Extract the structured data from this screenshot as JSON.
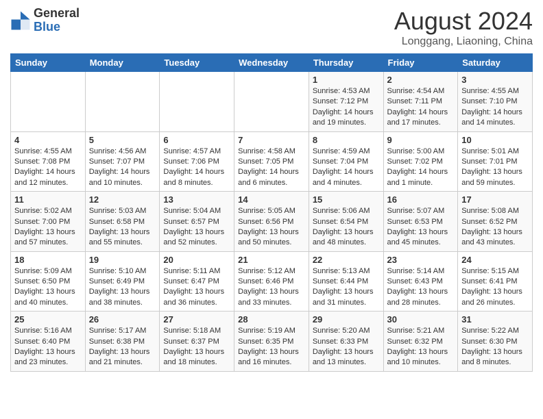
{
  "header": {
    "logo_general": "General",
    "logo_blue": "Blue",
    "month_title": "August 2024",
    "location": "Longgang, Liaoning, China"
  },
  "days_of_week": [
    "Sunday",
    "Monday",
    "Tuesday",
    "Wednesday",
    "Thursday",
    "Friday",
    "Saturday"
  ],
  "weeks": [
    [
      {
        "day": "",
        "content": ""
      },
      {
        "day": "",
        "content": ""
      },
      {
        "day": "",
        "content": ""
      },
      {
        "day": "",
        "content": ""
      },
      {
        "day": "1",
        "content": "Sunrise: 4:53 AM\nSunset: 7:12 PM\nDaylight: 14 hours\nand 19 minutes."
      },
      {
        "day": "2",
        "content": "Sunrise: 4:54 AM\nSunset: 7:11 PM\nDaylight: 14 hours\nand 17 minutes."
      },
      {
        "day": "3",
        "content": "Sunrise: 4:55 AM\nSunset: 7:10 PM\nDaylight: 14 hours\nand 14 minutes."
      }
    ],
    [
      {
        "day": "4",
        "content": "Sunrise: 4:55 AM\nSunset: 7:08 PM\nDaylight: 14 hours\nand 12 minutes."
      },
      {
        "day": "5",
        "content": "Sunrise: 4:56 AM\nSunset: 7:07 PM\nDaylight: 14 hours\nand 10 minutes."
      },
      {
        "day": "6",
        "content": "Sunrise: 4:57 AM\nSunset: 7:06 PM\nDaylight: 14 hours\nand 8 minutes."
      },
      {
        "day": "7",
        "content": "Sunrise: 4:58 AM\nSunset: 7:05 PM\nDaylight: 14 hours\nand 6 minutes."
      },
      {
        "day": "8",
        "content": "Sunrise: 4:59 AM\nSunset: 7:04 PM\nDaylight: 14 hours\nand 4 minutes."
      },
      {
        "day": "9",
        "content": "Sunrise: 5:00 AM\nSunset: 7:02 PM\nDaylight: 14 hours\nand 1 minute."
      },
      {
        "day": "10",
        "content": "Sunrise: 5:01 AM\nSunset: 7:01 PM\nDaylight: 13 hours\nand 59 minutes."
      }
    ],
    [
      {
        "day": "11",
        "content": "Sunrise: 5:02 AM\nSunset: 7:00 PM\nDaylight: 13 hours\nand 57 minutes."
      },
      {
        "day": "12",
        "content": "Sunrise: 5:03 AM\nSunset: 6:58 PM\nDaylight: 13 hours\nand 55 minutes."
      },
      {
        "day": "13",
        "content": "Sunrise: 5:04 AM\nSunset: 6:57 PM\nDaylight: 13 hours\nand 52 minutes."
      },
      {
        "day": "14",
        "content": "Sunrise: 5:05 AM\nSunset: 6:56 PM\nDaylight: 13 hours\nand 50 minutes."
      },
      {
        "day": "15",
        "content": "Sunrise: 5:06 AM\nSunset: 6:54 PM\nDaylight: 13 hours\nand 48 minutes."
      },
      {
        "day": "16",
        "content": "Sunrise: 5:07 AM\nSunset: 6:53 PM\nDaylight: 13 hours\nand 45 minutes."
      },
      {
        "day": "17",
        "content": "Sunrise: 5:08 AM\nSunset: 6:52 PM\nDaylight: 13 hours\nand 43 minutes."
      }
    ],
    [
      {
        "day": "18",
        "content": "Sunrise: 5:09 AM\nSunset: 6:50 PM\nDaylight: 13 hours\nand 40 minutes."
      },
      {
        "day": "19",
        "content": "Sunrise: 5:10 AM\nSunset: 6:49 PM\nDaylight: 13 hours\nand 38 minutes."
      },
      {
        "day": "20",
        "content": "Sunrise: 5:11 AM\nSunset: 6:47 PM\nDaylight: 13 hours\nand 36 minutes."
      },
      {
        "day": "21",
        "content": "Sunrise: 5:12 AM\nSunset: 6:46 PM\nDaylight: 13 hours\nand 33 minutes."
      },
      {
        "day": "22",
        "content": "Sunrise: 5:13 AM\nSunset: 6:44 PM\nDaylight: 13 hours\nand 31 minutes."
      },
      {
        "day": "23",
        "content": "Sunrise: 5:14 AM\nSunset: 6:43 PM\nDaylight: 13 hours\nand 28 minutes."
      },
      {
        "day": "24",
        "content": "Sunrise: 5:15 AM\nSunset: 6:41 PM\nDaylight: 13 hours\nand 26 minutes."
      }
    ],
    [
      {
        "day": "25",
        "content": "Sunrise: 5:16 AM\nSunset: 6:40 PM\nDaylight: 13 hours\nand 23 minutes."
      },
      {
        "day": "26",
        "content": "Sunrise: 5:17 AM\nSunset: 6:38 PM\nDaylight: 13 hours\nand 21 minutes."
      },
      {
        "day": "27",
        "content": "Sunrise: 5:18 AM\nSunset: 6:37 PM\nDaylight: 13 hours\nand 18 minutes."
      },
      {
        "day": "28",
        "content": "Sunrise: 5:19 AM\nSunset: 6:35 PM\nDaylight: 13 hours\nand 16 minutes."
      },
      {
        "day": "29",
        "content": "Sunrise: 5:20 AM\nSunset: 6:33 PM\nDaylight: 13 hours\nand 13 minutes."
      },
      {
        "day": "30",
        "content": "Sunrise: 5:21 AM\nSunset: 6:32 PM\nDaylight: 13 hours\nand 10 minutes."
      },
      {
        "day": "31",
        "content": "Sunrise: 5:22 AM\nSunset: 6:30 PM\nDaylight: 13 hours\nand 8 minutes."
      }
    ]
  ]
}
